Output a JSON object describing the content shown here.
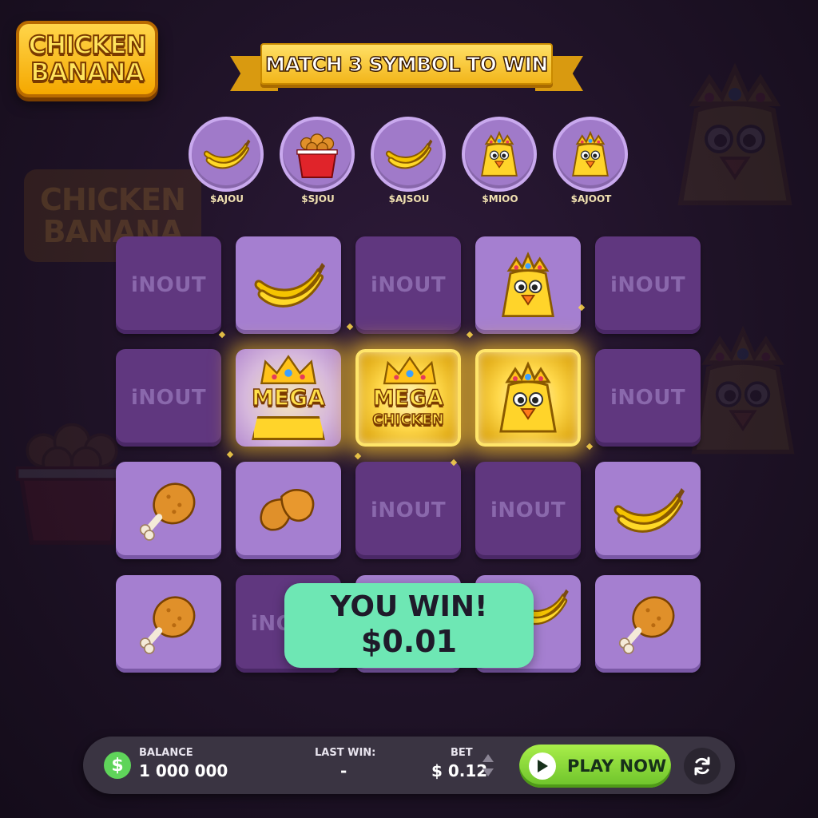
{
  "logo": {
    "line1": "CHICKEN",
    "line2": "BANANA"
  },
  "banner": {
    "text": "MATCH 3 SYMBOL TO WIN"
  },
  "paytable": [
    {
      "icon": "banana-icon",
      "label": "$AJOU"
    },
    {
      "icon": "chicken-bucket-icon",
      "label": "$SJOU"
    },
    {
      "icon": "banana-icon",
      "label": "$AJSOU"
    },
    {
      "icon": "crowned-chicken-icon",
      "label": "$MIOO"
    },
    {
      "icon": "crowned-chicken-icon",
      "label": "$AJOOT"
    }
  ],
  "grid": {
    "empty_label": "iNOUT",
    "rows": [
      [
        "empty",
        "banana",
        "empty",
        "crowned-chicken",
        "empty"
      ],
      [
        "empty",
        "mega",
        "mega-chicken",
        "crowned-chicken-win",
        "empty"
      ],
      [
        "drumstick",
        "nuggets",
        "empty",
        "empty",
        "banana"
      ],
      [
        "drumstick",
        "empty",
        "empty",
        "banana",
        "drumstick"
      ]
    ],
    "mega_label": "MEGA",
    "mega_chicken_line1": "MEGA",
    "mega_chicken_line2": "CHICKEN"
  },
  "win_popup": {
    "title": "YOU WIN!",
    "amount": "$0.01"
  },
  "bottom_bar": {
    "balance_label": "BALANCE",
    "balance_value": "1 000 000",
    "last_win_label": "LAST WIN:",
    "last_win_value": "-",
    "bet_label": "BET",
    "bet_value": "$ 0.12",
    "play_label": "PLAY NOW",
    "coin_symbol": "$"
  },
  "colors": {
    "tile_filled": "#a57fd0",
    "tile_empty": "#60377f",
    "win_gold": "#ffd84a",
    "popup_green": "#6ee7b4",
    "play_green": "#8ad83a"
  }
}
